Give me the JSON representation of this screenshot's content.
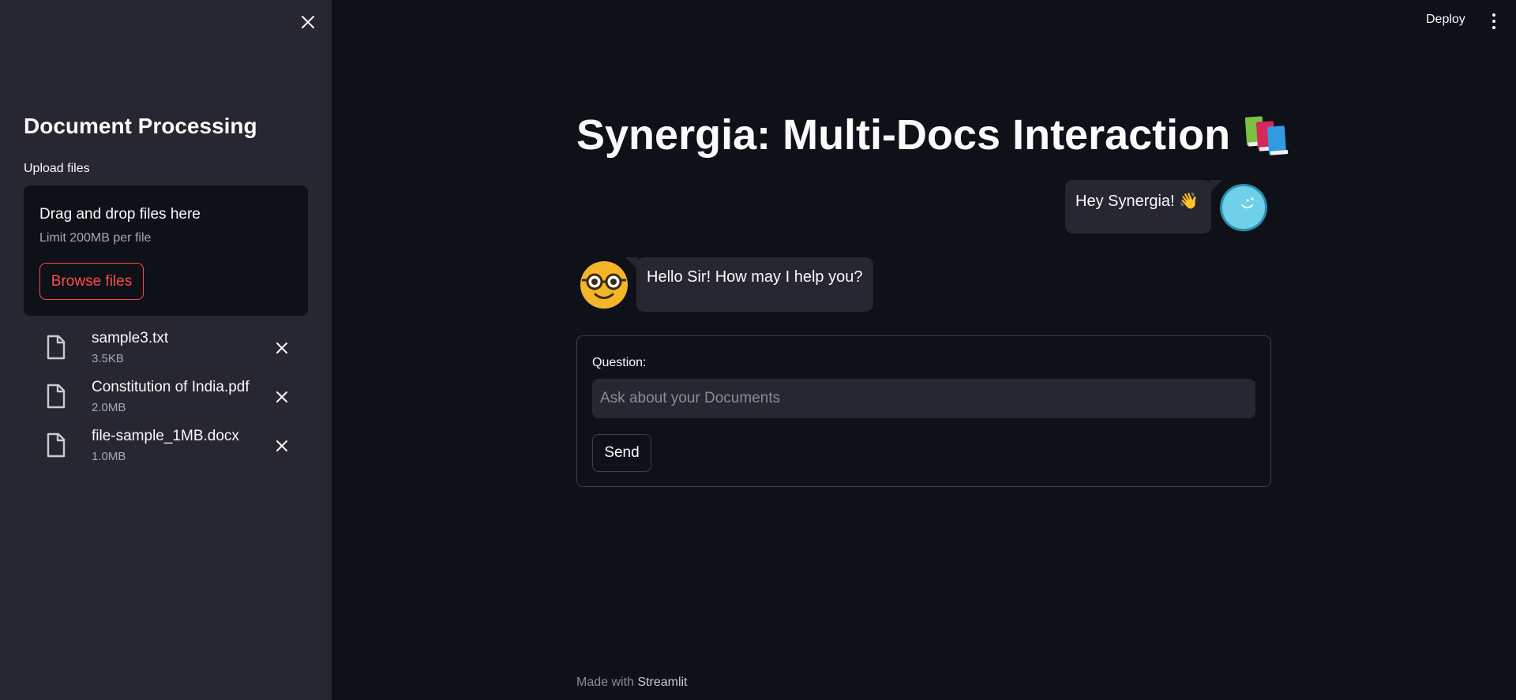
{
  "sidebar": {
    "title": "Document Processing",
    "upload_label": "Upload files",
    "dropzone": {
      "title": "Drag and drop files here",
      "limit": "Limit 200MB per file",
      "browse_label": "Browse files"
    },
    "files": [
      {
        "name": "sample3.txt",
        "size": "3.5KB"
      },
      {
        "name": "Constitution of India.pdf",
        "size": "2.0MB"
      },
      {
        "name": "file-sample_1MB.docx",
        "size": "1.0MB"
      }
    ]
  },
  "header": {
    "deploy_label": "Deploy"
  },
  "main": {
    "title": "Synergia: Multi-Docs Interaction",
    "title_icon": "books-icon",
    "messages": [
      {
        "role": "user",
        "text": "Hey Synergia! 👋"
      },
      {
        "role": "bot",
        "text": "Hello Sir! How may I help you?"
      }
    ],
    "form": {
      "label": "Question:",
      "placeholder": "Ask about your Documents",
      "value": "",
      "send_label": "Send"
    }
  },
  "footer": {
    "prefix": "Made with",
    "link": "Streamlit"
  },
  "colors": {
    "background": "#0e1117",
    "sidebar": "#262730",
    "accent": "#ff4b4b"
  }
}
